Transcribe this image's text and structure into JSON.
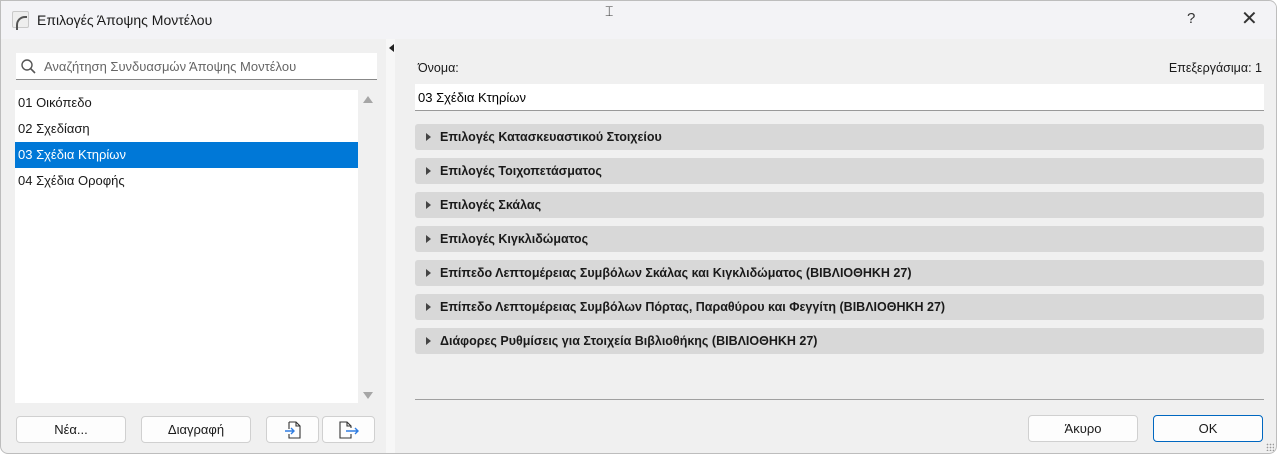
{
  "window": {
    "title": "Επιλογές Άποψης Μοντέλου",
    "help_label": "?",
    "close_label": "✕"
  },
  "left": {
    "search_placeholder": "Αναζήτηση Συνδυασμών Άποψης Μοντέλου",
    "items": [
      "01 Οικόπεδο",
      "02 Σχεδίαση",
      "03 Σχέδια Κτηρίων",
      "04 Σχέδια Οροφής"
    ],
    "selected_index": 2,
    "new_label": "Νέα...",
    "delete_label": "Διαγραφή"
  },
  "right": {
    "name_label": "Όνομα:",
    "editable_label": "Επεξεργάσιμα: 1",
    "name_value": "03 Σχέδια Κτηρίων",
    "sections": [
      "Επιλογές Κατασκευαστικού Στοιχείου",
      "Επιλογές Τοιχοπετάσματος",
      "Επιλογές Σκάλας",
      "Επιλογές Κιγκλιδώματος",
      "Επίπεδο Λεπτομέρειας Συμβόλων Σκάλας και Κιγκλιδώματος (ΒΙΒΛΙΟΘΗΚΗ 27)",
      "Επίπεδο Λεπτομέρειας Συμβόλων Πόρτας, Παραθύρου και Φεγγίτη (ΒΙΒΛΙΟΘΗΚΗ 27)",
      "Διάφορες Ρυθμίσεις για Στοιχεία Βιβλιοθήκης (ΒΙΒΛΙΟΘΗΚΗ 27)"
    ],
    "cancel_label": "Άκυρο",
    "ok_label": "OK"
  },
  "colors": {
    "selection": "#0078d7",
    "accent": "#0067c0",
    "icon_blue": "#2f7de1"
  }
}
